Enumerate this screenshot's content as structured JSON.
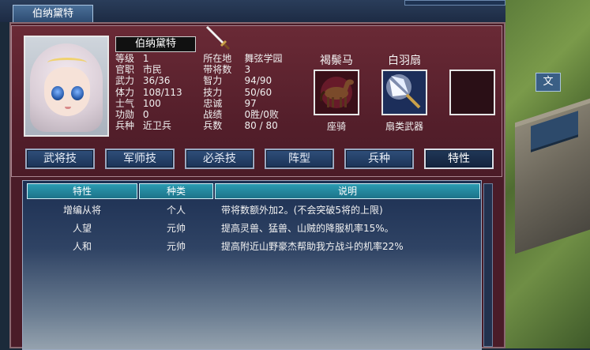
{
  "window": {
    "title_tab": "伯纳黛特",
    "map_badge": "文"
  },
  "character": {
    "name": "伯纳黛特",
    "stats": [
      {
        "k1": "等级",
        "v1": "1",
        "k2": "所在地",
        "v2": "舞弦学园"
      },
      {
        "k1": "官职",
        "v1": "市民",
        "k2": "带将数",
        "v2": "3"
      },
      {
        "k1": "武力",
        "v1": "36/36",
        "k2": "智力",
        "v2": "94/90"
      },
      {
        "k1": "体力",
        "v1": "108/113",
        "k2": "技力",
        "v2": "50/60"
      },
      {
        "k1": "士气",
        "v1": "100",
        "k2": "忠诚",
        "v2": "97"
      },
      {
        "k1": "功勋",
        "v1": "0",
        "k2": "战绩",
        "v2": "0胜/0败"
      },
      {
        "k1": "兵种",
        "v1": "近卫兵",
        "k2": "兵数",
        "v2": "80 / 80"
      }
    ]
  },
  "equipment": {
    "mount": {
      "name": "褐鬃马",
      "label": "座骑",
      "icon": "horse-icon"
    },
    "weapon": {
      "name": "白羽扇",
      "label": "扇类武器",
      "icon": "feather-fan-icon"
    },
    "empty": {
      "name": "",
      "label": ""
    }
  },
  "tabs": [
    "武将技",
    "军师技",
    "必杀技",
    "阵型",
    "兵种",
    "特性"
  ],
  "active_tab": "特性",
  "table": {
    "headers": [
      "特性",
      "种类",
      "说明"
    ],
    "rows": [
      {
        "trait": "增编从将",
        "type": "个人",
        "desc": "带将数额外加2。(不会突破5将的上限)"
      },
      {
        "trait": "人望",
        "type": "元帅",
        "desc": "提高灵兽、猛兽、山贼的降服机率15%。"
      },
      {
        "trait": "人和",
        "type": "元帅",
        "desc": "提高附近山野豪杰帮助我方战斗的机率22%"
      }
    ]
  },
  "colors": {
    "panel": "#4a1c28",
    "tab_blue": "#2f4f7a",
    "header_teal": "#2b9bb2"
  }
}
